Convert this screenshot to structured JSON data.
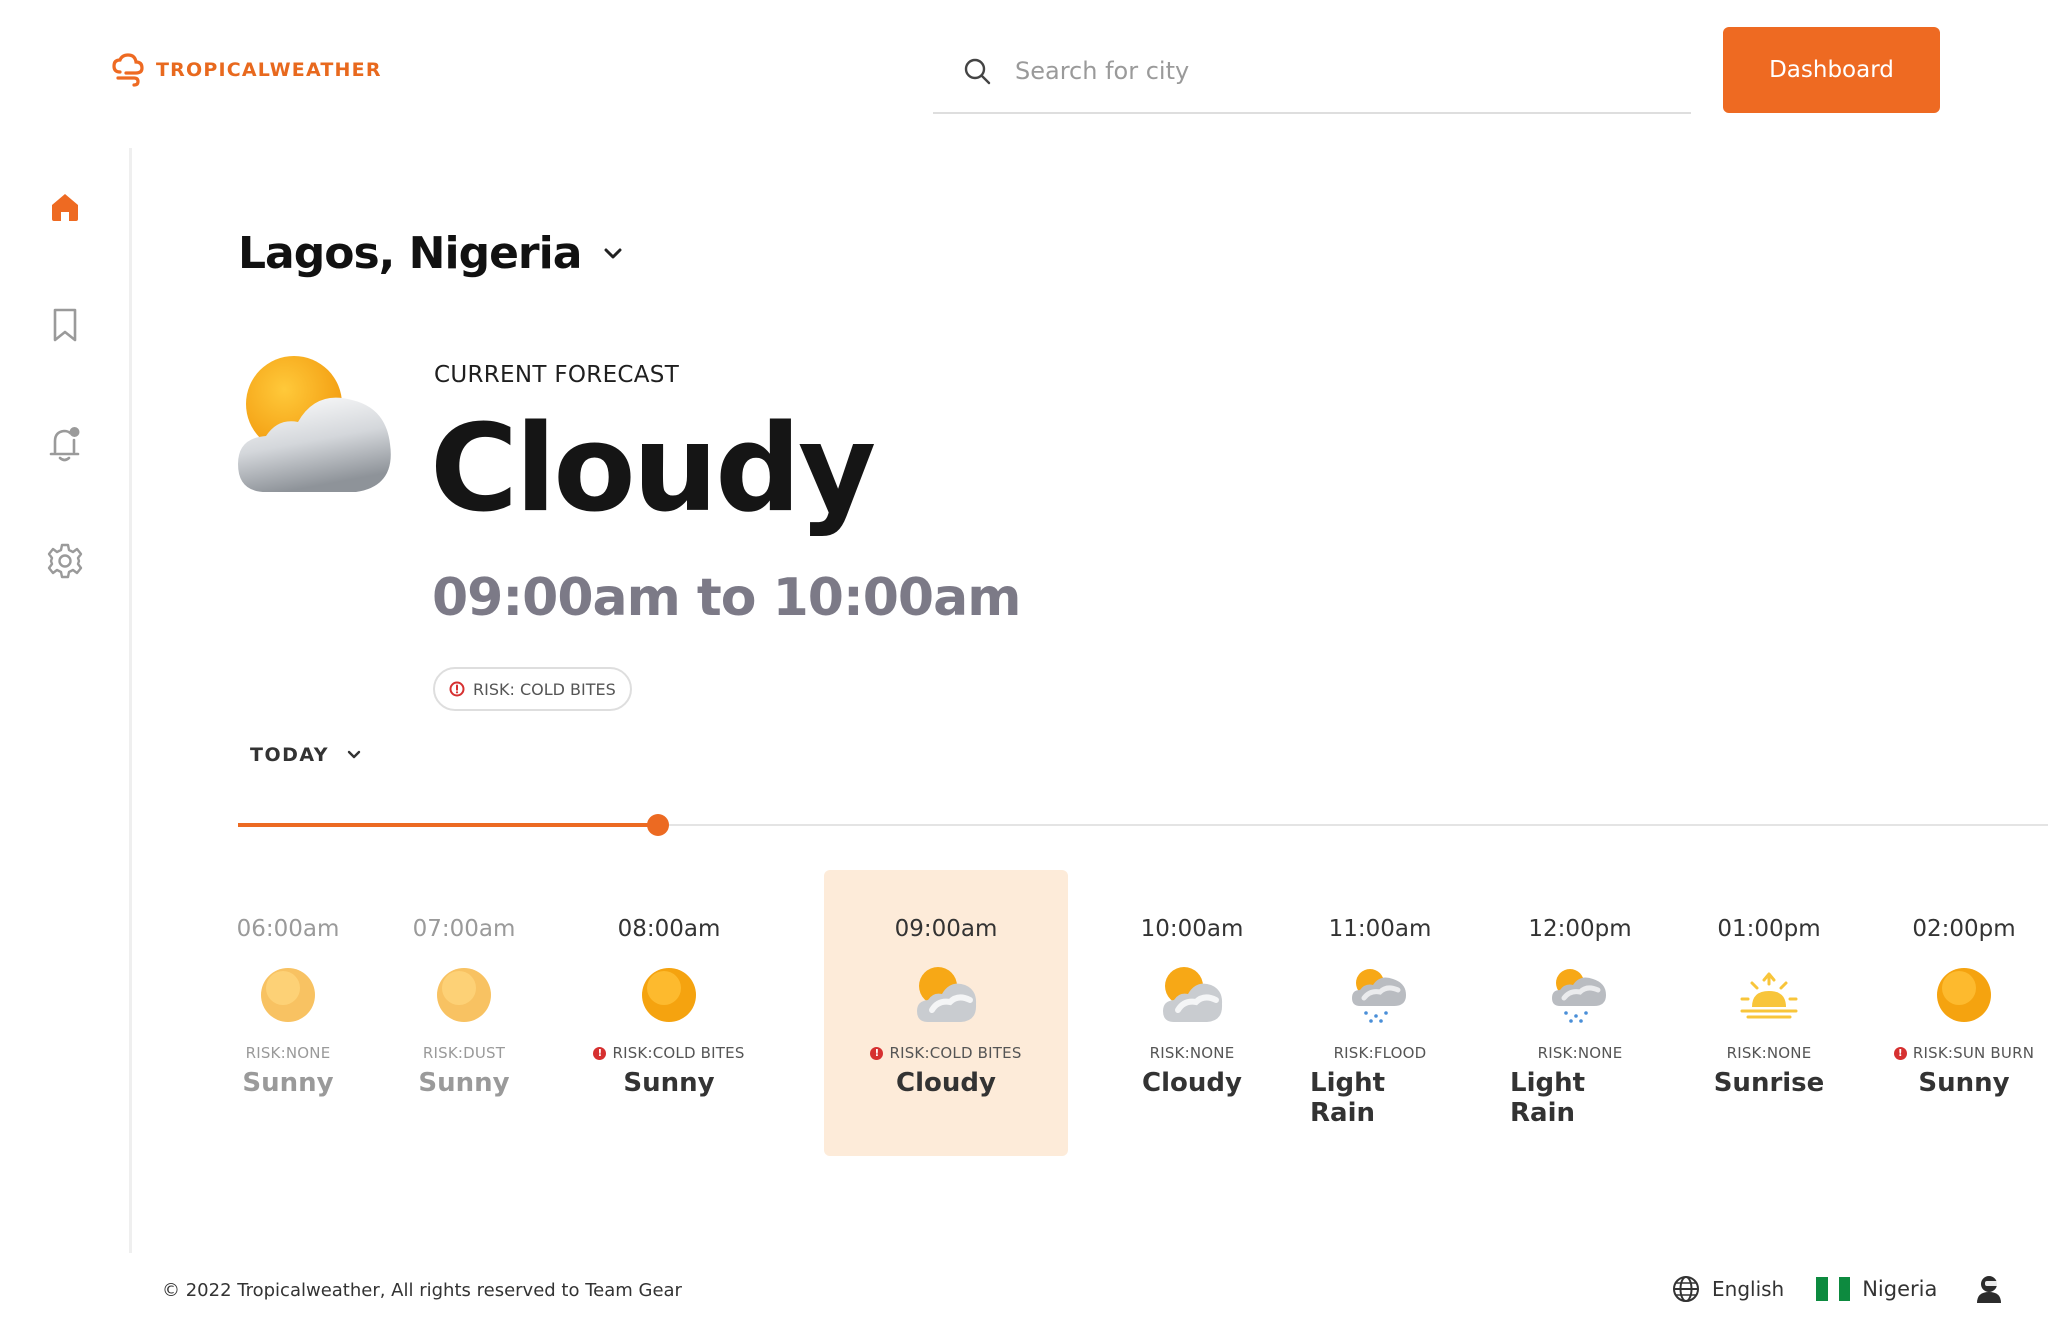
{
  "brand": {
    "name": "TROPICALWEATHER",
    "color": "#ee6a22"
  },
  "search": {
    "placeholder": "Search for city",
    "value": ""
  },
  "header": {
    "dashboard_label": "Dashboard"
  },
  "sidebar": {
    "items": [
      {
        "icon": "home-icon",
        "active": true
      },
      {
        "icon": "bookmark-icon",
        "active": false
      },
      {
        "icon": "notification-bell-icon",
        "active": false
      },
      {
        "icon": "gear-icon",
        "active": false
      }
    ]
  },
  "location": {
    "city": "Lagos, Nigeria"
  },
  "current": {
    "label": "CURRENT FORECAST",
    "condition": "Cloudy",
    "timespan": "09:00am to 10:00am",
    "risk": "RISK: COLD BITES",
    "icon": "sun-behind-cloud-icon"
  },
  "period": {
    "label": "TODAY"
  },
  "timeline": {
    "progress": 0.232
  },
  "hours": [
    {
      "time": "06:00am",
      "risk": "RISK:NONE",
      "condition": "Sunny",
      "icon": "sun-icon",
      "alert": false,
      "dim": true,
      "active": false
    },
    {
      "time": "07:00am",
      "risk": "RISK:DUST",
      "condition": "Sunny",
      "icon": "sun-icon",
      "alert": false,
      "dim": true,
      "active": false
    },
    {
      "time": "08:00am",
      "risk": "RISK:COLD BITES",
      "condition": "Sunny",
      "icon": "sun-icon",
      "alert": true,
      "dim": false,
      "active": false
    },
    {
      "time": "09:00am",
      "risk": "RISK:COLD BITES",
      "condition": "Cloudy",
      "icon": "sun-behind-cloud-icon",
      "alert": true,
      "dim": false,
      "active": true
    },
    {
      "time": "10:00am",
      "risk": "RISK:NONE",
      "condition": "Cloudy",
      "icon": "sun-behind-cloud-icon",
      "alert": false,
      "dim": false,
      "active": false
    },
    {
      "time": "11:00am",
      "risk": "RISK:FLOOD",
      "condition": "Light Rain",
      "icon": "rain-cloud-icon",
      "alert": false,
      "dim": false,
      "active": false
    },
    {
      "time": "12:00pm",
      "risk": "RISK:NONE",
      "condition": "Light Rain",
      "icon": "rain-cloud-icon",
      "alert": false,
      "dim": false,
      "active": false
    },
    {
      "time": "01:00pm",
      "risk": "RISK:NONE",
      "condition": "Sunrise",
      "icon": "sunrise-icon",
      "alert": false,
      "dim": false,
      "active": false
    },
    {
      "time": "02:00pm",
      "risk": "RISK:SUN BURN",
      "condition": "Sunny",
      "icon": "sun-icon",
      "alert": true,
      "dim": false,
      "active": false
    }
  ],
  "footer": {
    "copyright": "© 2022 Tropicalweather, All rights reserved to Team Gear",
    "language": "English",
    "country": "Nigeria",
    "flag_colors": [
      "#0d8a3f",
      "#ffffff",
      "#0d8a3f"
    ]
  }
}
